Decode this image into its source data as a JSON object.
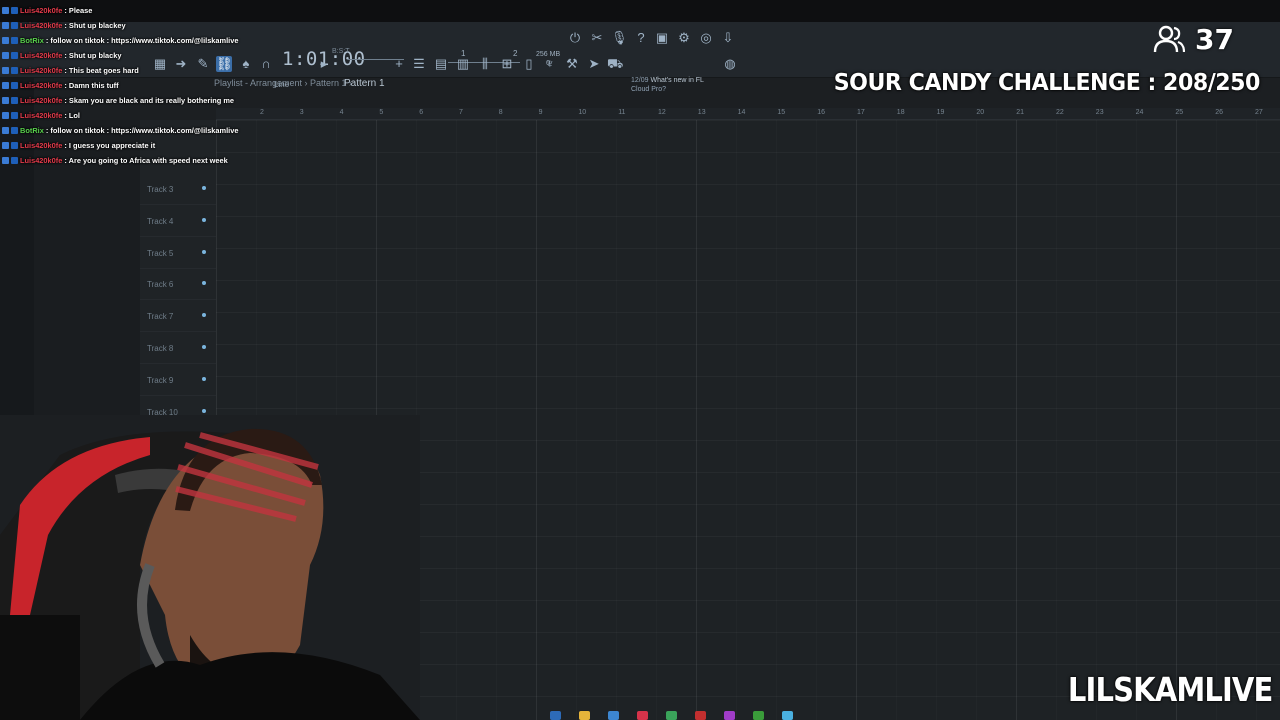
{
  "chat": {
    "messages": [
      {
        "user": "Luis420k0fe",
        "user_color": "#e23a4a",
        "text": "Please"
      },
      {
        "user": "Luis420k0fe",
        "user_color": "#e23a4a",
        "text": "Shut up blackey"
      },
      {
        "user": "BotRix",
        "user_color": "#59d14d",
        "text": "follow on tiktok : https://www.tiktok.com/@lilskamlive"
      },
      {
        "user": "Luis420k0fe",
        "user_color": "#e23a4a",
        "text": "Shut up blacky"
      },
      {
        "user": "Luis420k0fe",
        "user_color": "#e23a4a",
        "text": "This beat goes hard"
      },
      {
        "user": "Luis420k0fe",
        "user_color": "#e23a4a",
        "text": "Damn this tuff"
      },
      {
        "user": "Luis420k0fe",
        "user_color": "#e23a4a",
        "text": "Skam you are black and its really bothering me"
      },
      {
        "user": "Luis420k0fe",
        "user_color": "#e23a4a",
        "text": "Lol"
      },
      {
        "user": "BotRix",
        "user_color": "#59d14d",
        "text": "follow on tiktok : https://www.tiktok.com/@lilskamlive"
      },
      {
        "user": "Luis420k0fe",
        "user_color": "#e23a4a",
        "text": "I guess you appreciate it"
      },
      {
        "user": "Luis420k0fe",
        "user_color": "#e23a4a",
        "text": "Are you going to Africa with speed next week"
      }
    ]
  },
  "stream": {
    "viewer_count": "37",
    "challenge_text": "SOUR CANDY CHALLENGE : 208/250",
    "channel_name": "LILSKAMLIVE"
  },
  "fl": {
    "time": "1:01:00",
    "time_sub": "B:S:T",
    "tempo_marks": [
      "1",
      "2"
    ],
    "memory": "256 MB",
    "cpu": "0",
    "line_mode": "Line",
    "pattern": "Pattern 1",
    "news_date": "12/09",
    "news_title": "What's new in FL",
    "news_sub": "Cloud Pro?",
    "breadcrumb": "Playlist - Arrangement › Pattern 1 ›",
    "ruler": [
      "2",
      "3",
      "4",
      "5",
      "6",
      "7",
      "8",
      "9",
      "10",
      "11",
      "12",
      "13",
      "14",
      "15",
      "16",
      "17",
      "18",
      "19",
      "20",
      "21",
      "22",
      "23",
      "24",
      "25",
      "26",
      "27"
    ],
    "tracks": [
      "Track 3",
      "Track 4",
      "Track 5",
      "Track 6",
      "Track 7",
      "Track 8",
      "Track 9",
      "Track 10"
    ]
  },
  "colors": {
    "viewer_icon": "#ffffff",
    "led": "#7ab4dd",
    "accent": "#4a90d9"
  }
}
